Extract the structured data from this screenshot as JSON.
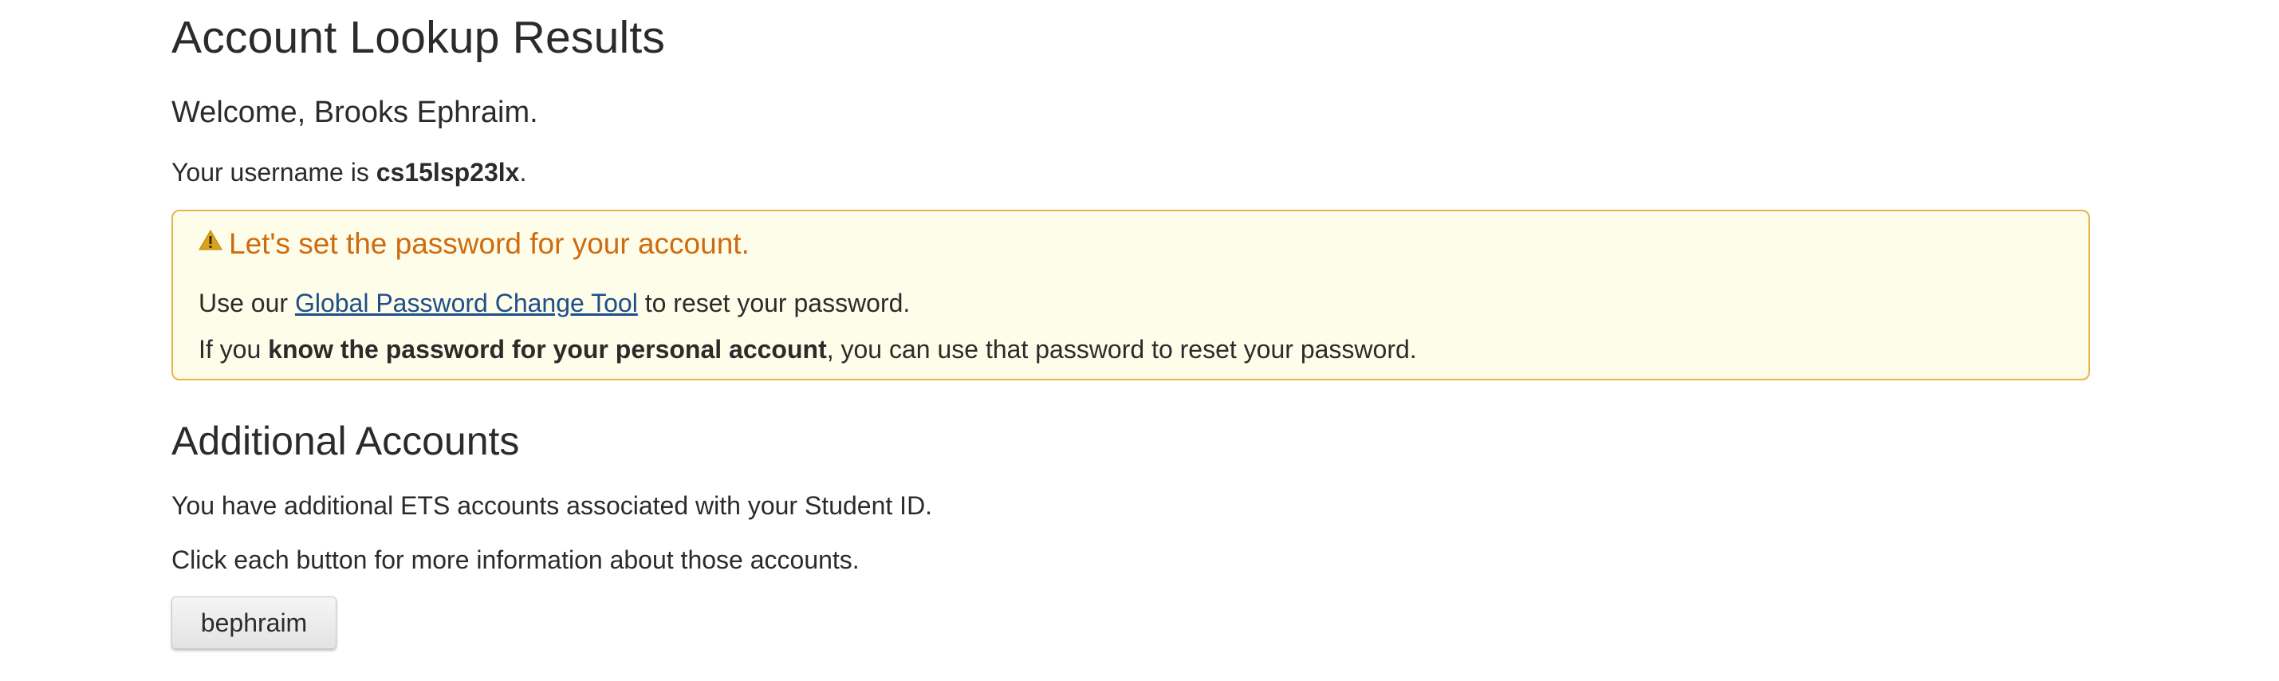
{
  "page": {
    "title": "Account Lookup Results",
    "welcome": "Welcome, Brooks Ephraim.",
    "username_prefix": "Your username is ",
    "username": "cs15lsp23lx",
    "username_suffix": "."
  },
  "notice": {
    "icon": "warning-icon",
    "title": "Let's set the password for your account.",
    "line1_prefix": "Use our ",
    "line1_link": "Global Password Change Tool",
    "line1_suffix": " to reset your password.",
    "line2_prefix": "If you ",
    "line2_bold": "know the password for your personal account",
    "line2_suffix": ", you can use that password to reset your password.",
    "colors": {
      "background": "#fefdea",
      "border": "#e8b44a",
      "title": "#cf6b0f",
      "link": "#1e4f8a"
    }
  },
  "additional": {
    "heading": "Additional Accounts",
    "para1": "You have additional ETS accounts associated with your Student ID.",
    "para2": "Click each button for more information about those accounts.",
    "buttons": [
      {
        "label": "bephraim"
      }
    ]
  }
}
